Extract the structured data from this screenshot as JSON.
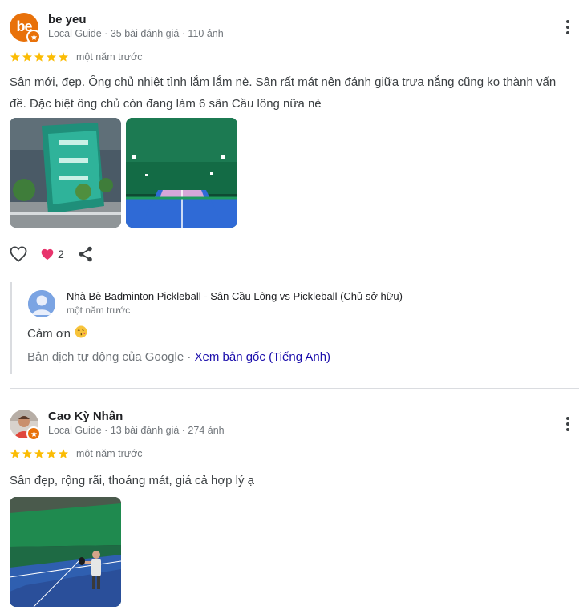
{
  "reviews": [
    {
      "author": "be yeu",
      "avatar_text": "be",
      "avatar_color": "#e8710a",
      "meta": "Local Guide · 35 bài đánh giá · 110 ảnh",
      "rating": 5,
      "time": "một năm trước",
      "text": "Sân mới, đẹp. Ông chủ nhiệt tình lắm lắm nè. Sân rất mát nên đánh giữa trưa nắng cũng ko thành vấn đề. Đặc biệt ông chủ còn đang làm 6 sân Cầu lông nữa nè",
      "reaction_count": "2",
      "owner_response": {
        "name": "Nhà Bè Badminton Pickleball - Sân Cầu Lông vs Pickleball (Chủ sở hữu)",
        "time": "một năm trước",
        "text": "Cảm ơn",
        "translation_note": "Bản dịch tự động của Google · ",
        "translation_link": "Xem bản gốc (Tiếng Anh)"
      }
    },
    {
      "author": "Cao Kỳ Nhân",
      "meta": "Local Guide · 13 bài đánh giá · 274 ảnh",
      "rating": 5,
      "time": "một năm trước",
      "text": "Sân đẹp, rộng rãi, thoáng mát, giá cả hợp lý ạ"
    }
  ],
  "colors": {
    "star": "#fbbc04",
    "heart": "#e8336c",
    "link": "#1a0dab",
    "guide_badge": "#e8710a"
  },
  "icons": [
    "local-guide-badge-icon",
    "star-icon",
    "more-vert-icon",
    "heart-outline-icon",
    "heart-reaction-icon",
    "share-icon",
    "person-icon",
    "kiss-emoji-icon"
  ]
}
